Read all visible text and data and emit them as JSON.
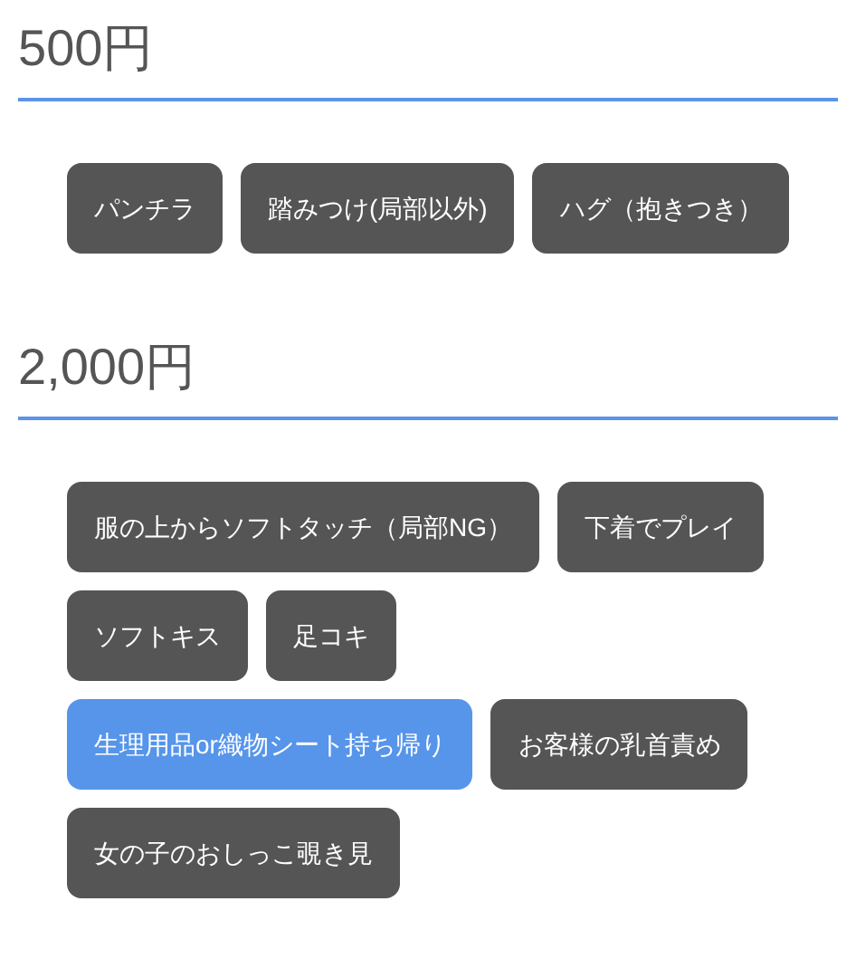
{
  "sections": [
    {
      "price": "500円",
      "options": [
        {
          "label": "パンチラ",
          "selected": false
        },
        {
          "label": "踏みつけ(局部以外)",
          "selected": false
        },
        {
          "label": "ハグ（抱きつき）",
          "selected": false
        }
      ]
    },
    {
      "price": "2,000円",
      "options": [
        {
          "label": "服の上からソフトタッチ（局部NG）",
          "selected": false
        },
        {
          "label": "下着でプレイ",
          "selected": false
        },
        {
          "label": "ソフトキス",
          "selected": false
        },
        {
          "label": "足コキ",
          "selected": false
        },
        {
          "label": "生理用品or織物シート持ち帰り",
          "selected": true
        },
        {
          "label": "お客様の乳首責め",
          "selected": false
        },
        {
          "label": "女の子のおしっこ覗き見",
          "selected": false
        }
      ]
    }
  ]
}
